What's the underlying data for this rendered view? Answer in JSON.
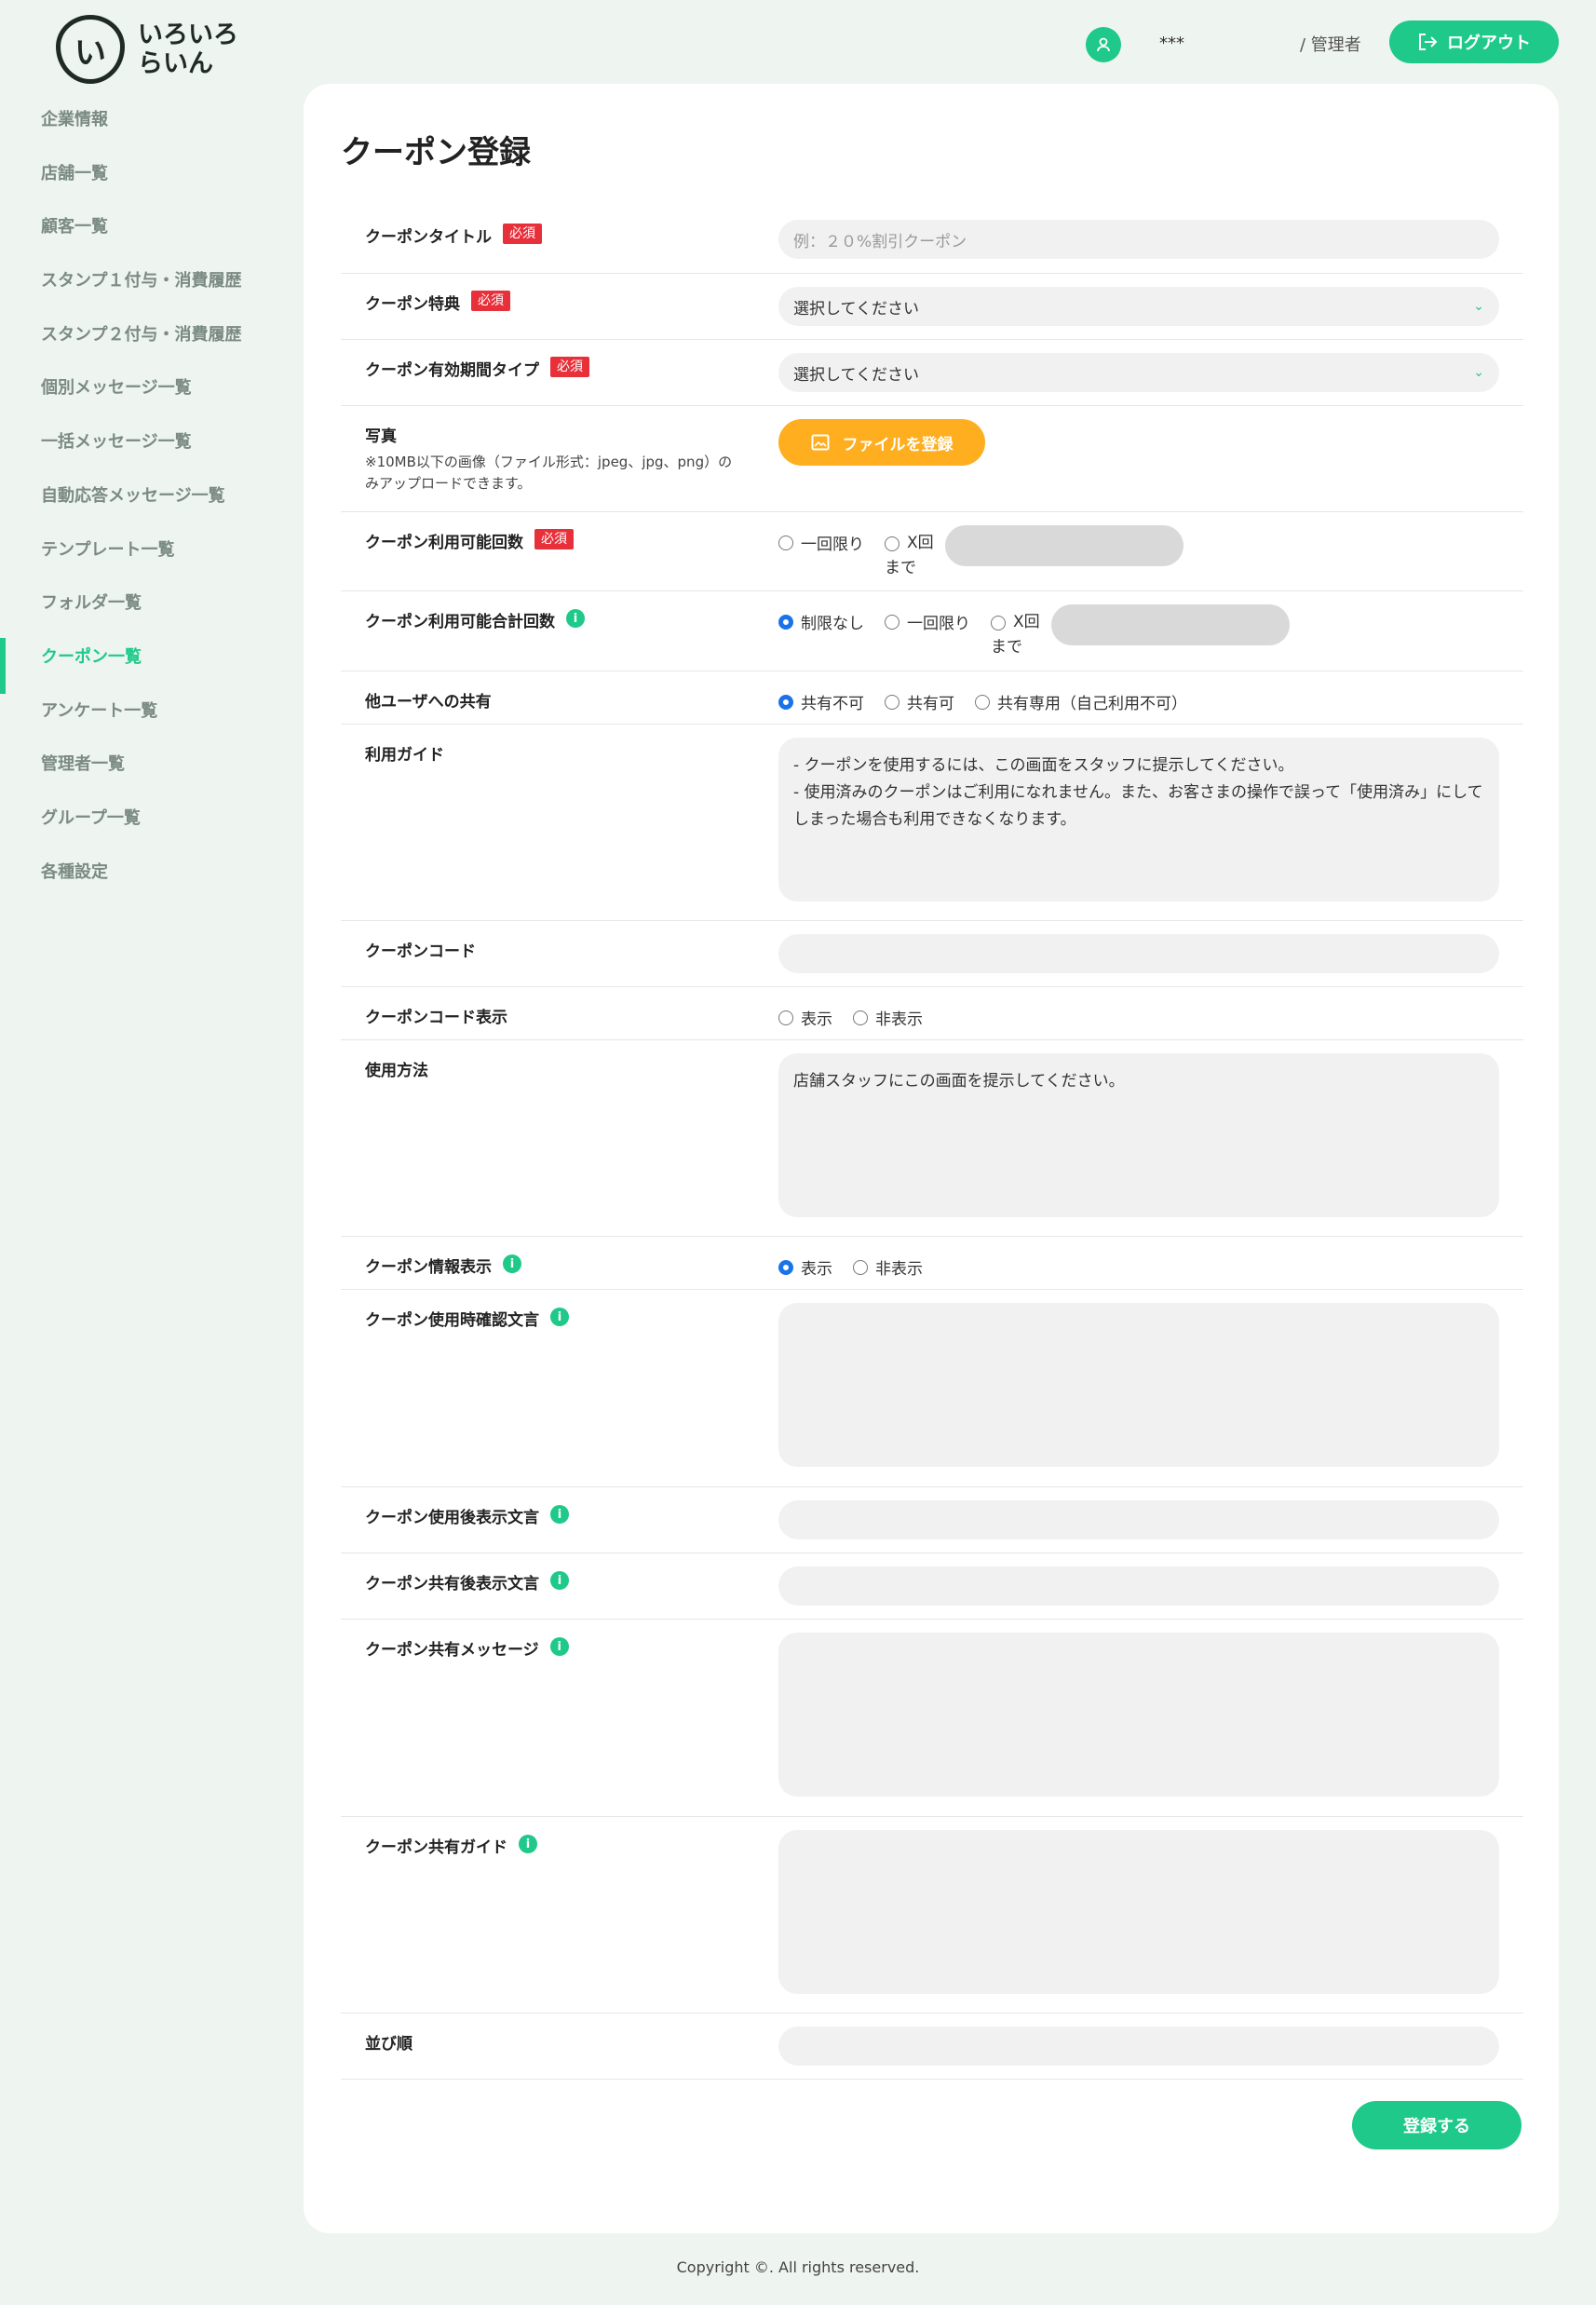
{
  "brand": {
    "logo_mark": "い",
    "line1": "いろいろ",
    "line2": "らいん"
  },
  "header": {
    "user_name": "***",
    "user_role": "/ 管理者",
    "logout_label": "ログアウト"
  },
  "sidebar": {
    "items": [
      {
        "label": "企業情報"
      },
      {
        "label": "店舗一覧"
      },
      {
        "label": "顧客一覧"
      },
      {
        "label": "スタンプ１付与・消費履歴"
      },
      {
        "label": "スタンプ２付与・消費履歴"
      },
      {
        "label": "個別メッセージ一覧"
      },
      {
        "label": "一括メッセージ一覧"
      },
      {
        "label": "自動応答メッセージ一覧"
      },
      {
        "label": "テンプレート一覧"
      },
      {
        "label": "フォルダ一覧"
      },
      {
        "label": "クーポン一覧",
        "active": true
      },
      {
        "label": "アンケート一覧"
      },
      {
        "label": "管理者一覧"
      },
      {
        "label": "グループ一覧"
      },
      {
        "label": "各種設定"
      }
    ]
  },
  "page": {
    "title": "クーポン登録"
  },
  "required_badge": "必須",
  "info_icon": "i",
  "form": {
    "title_label": "クーポンタイトル",
    "title_placeholder": "例：２０%割引クーポン",
    "benefit_label": "クーポン特典",
    "benefit_value": "選択してください",
    "period_label": "クーポン有効期間タイプ",
    "period_value": "選択してください",
    "photo_label": "写真",
    "photo_note": "※10MB以下の画像（ファイル形式：jpeg、jpg、png）のみアップロードできます。",
    "photo_button": "ファイルを登録",
    "usable_count_label": "クーポン利用可能回数",
    "usable_count_options": [
      "一回限り",
      "X回",
      "まで"
    ],
    "usable_total_label": "クーポン利用可能合計回数",
    "usable_total_options": [
      "制限なし",
      "一回限り",
      "X回",
      "まで"
    ],
    "share_label": "他ユーザへの共有",
    "share_options": [
      "共有不可",
      "共有可",
      "共有専用（自己利用不可）"
    ],
    "guide_label": "利用ガイド",
    "guide_text_1": "- クーポンを使用するには、この画面をスタッフに提示してください。",
    "guide_text_2": "- 使用済みのクーポンはご利用になれません。また、お客さまの操作で誤って「使用済み」にしてしまった場合も利用できなくなります。",
    "code_label": "クーポンコード",
    "code_display_label": "クーポンコード表示",
    "code_display_options": [
      "表示",
      "非表示"
    ],
    "usage_label": "使用方法",
    "usage_text": "店舗スタッフにこの画面を提示してください。",
    "info_display_label": "クーポン情報表示",
    "info_display_options": [
      "表示",
      "非表示"
    ],
    "confirm_text_label": "クーポン使用時確認文言",
    "after_use_label": "クーポン使用後表示文言",
    "after_share_label": "クーポン共有後表示文言",
    "share_message_label": "クーポン共有メッセージ",
    "share_guide_label": "クーポン共有ガイド",
    "order_label": "並び順",
    "submit_label": "登録する"
  },
  "footer": {
    "copyright": "Copyright ©. All rights reserved."
  }
}
